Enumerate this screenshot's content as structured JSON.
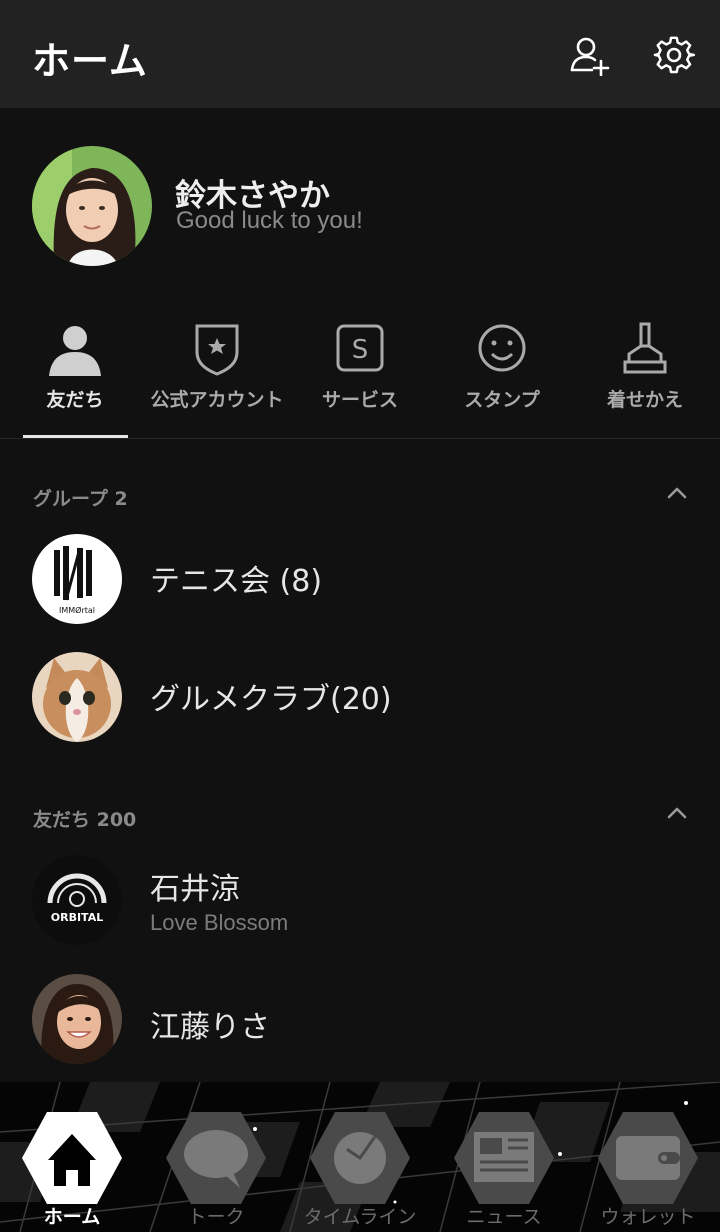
{
  "header": {
    "title": "ホーム",
    "add_friend_icon": "add-friend-icon",
    "settings_icon": "gear-icon"
  },
  "profile": {
    "name": "鈴木さやか",
    "status": "Good luck to you!"
  },
  "tabs": [
    {
      "label": "友だち",
      "icon": "person-icon",
      "active": true
    },
    {
      "label": "公式アカウント",
      "icon": "official-badge-icon",
      "active": false
    },
    {
      "label": "サービス",
      "icon": "service-s-icon",
      "active": false
    },
    {
      "label": "スタンプ",
      "icon": "smiley-icon",
      "active": false
    },
    {
      "label": "着せかえ",
      "icon": "brush-icon",
      "active": false
    }
  ],
  "groups": {
    "header": "グループ 2",
    "items": [
      {
        "name": "テニス会 (8)",
        "avatar_text": "IMMØrtal"
      },
      {
        "name": "グルメクラブ(20)"
      }
    ]
  },
  "friends": {
    "header": "友だち 200",
    "items": [
      {
        "name": "石井涼",
        "status": "Love Blossom",
        "avatar_text": "ORBITAL"
      },
      {
        "name": "江藤りさ",
        "status": ""
      }
    ]
  },
  "bottom_nav": [
    {
      "label": "ホーム",
      "icon": "home-icon",
      "active": true
    },
    {
      "label": "トーク",
      "icon": "chat-bubble-icon",
      "active": false
    },
    {
      "label": "タイムライン",
      "icon": "clock-icon",
      "active": false
    },
    {
      "label": "ニュース",
      "icon": "newspaper-icon",
      "active": false
    },
    {
      "label": "ウォレット",
      "icon": "wallet-icon",
      "active": false
    }
  ]
}
